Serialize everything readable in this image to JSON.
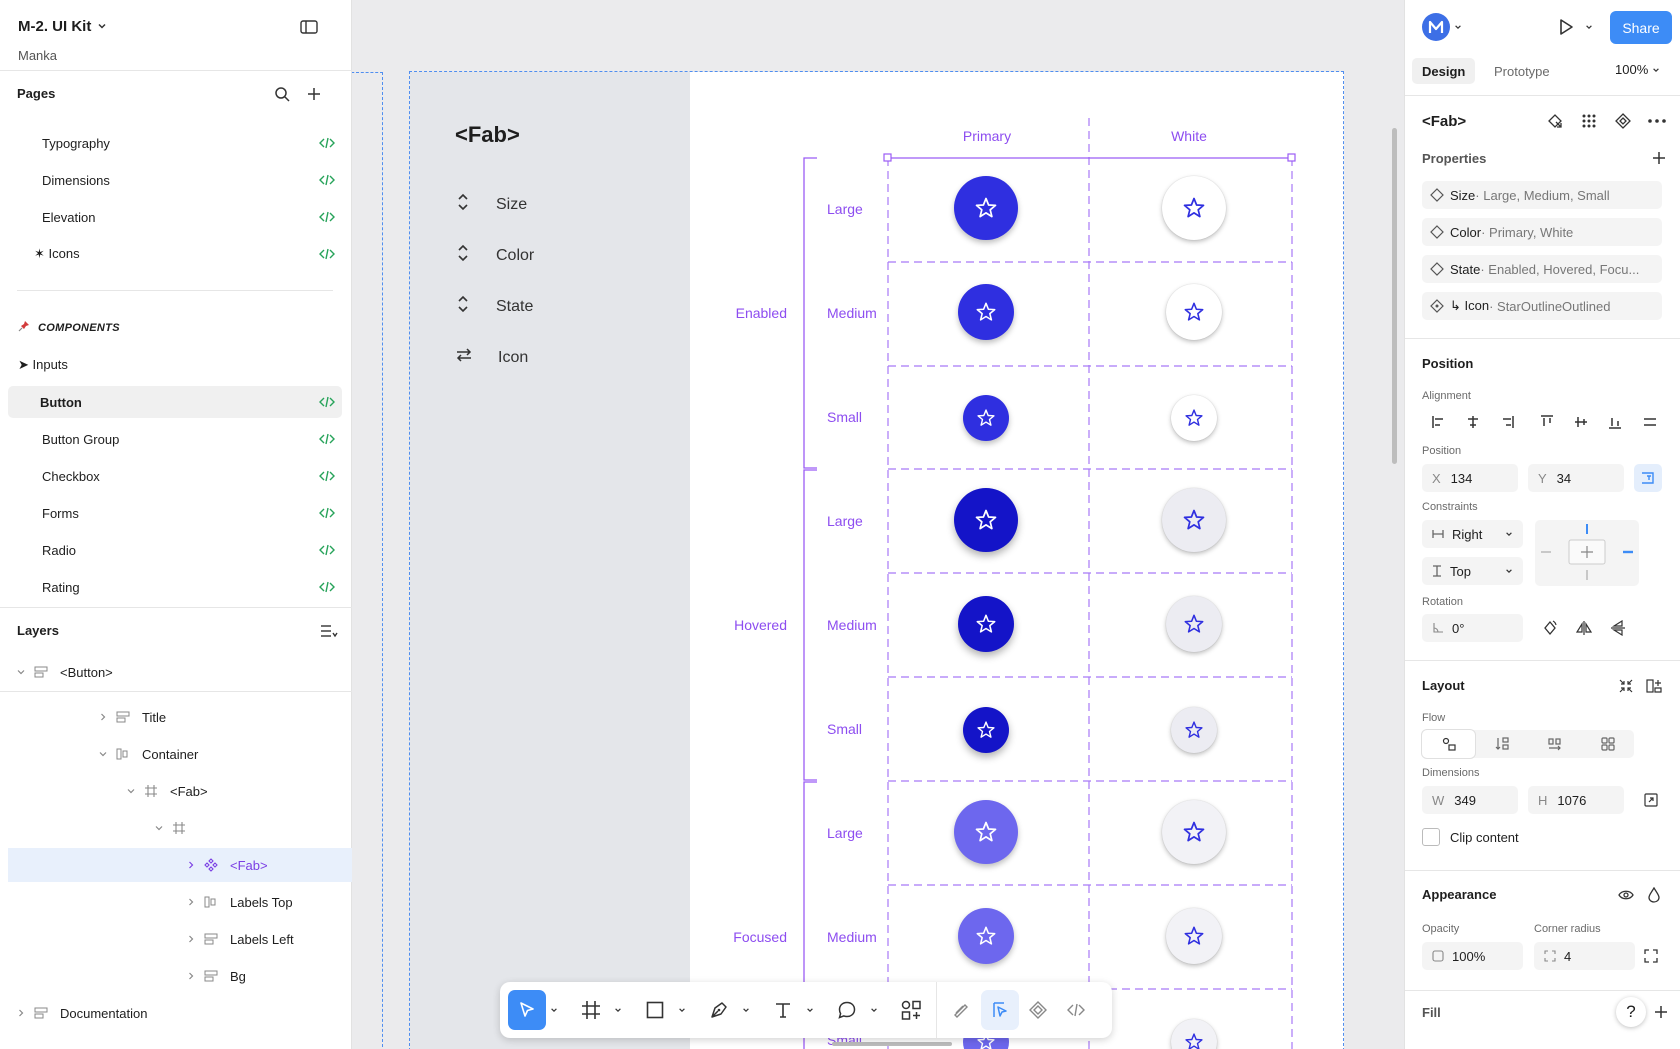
{
  "app": {
    "file_title": "M-2. UI Kit",
    "file_owner": "Manka"
  },
  "pages": {
    "heading": "Pages",
    "items": [
      {
        "label": "Typography"
      },
      {
        "label": "Dimensions"
      },
      {
        "label": "Elevation"
      },
      {
        "label": "✶ Icons"
      }
    ],
    "components_heading": "COMPONENTS",
    "component_items": [
      {
        "label": "➤ Inputs"
      },
      {
        "label": "Button"
      },
      {
        "label": "Button Group"
      },
      {
        "label": "Checkbox"
      },
      {
        "label": "Forms"
      },
      {
        "label": "Radio"
      },
      {
        "label": "Rating"
      }
    ]
  },
  "layers": {
    "heading": "Layers",
    "items": [
      {
        "label": "<Button>"
      },
      {
        "label": "Title"
      },
      {
        "label": "Container"
      },
      {
        "label": "<Fab>"
      },
      {
        "label": ""
      },
      {
        "label": "<Fab>"
      },
      {
        "label": "Labels Top"
      },
      {
        "label": "Labels Left"
      },
      {
        "label": "Bg"
      },
      {
        "label": "Documentation"
      }
    ]
  },
  "canvas": {
    "doc_title": "<Fab>",
    "doc_props": [
      {
        "label": "Size"
      },
      {
        "label": "Color"
      },
      {
        "label": "State"
      },
      {
        "label": "Icon"
      }
    ],
    "columns": [
      "Primary",
      "White"
    ],
    "groups": [
      "Enabled",
      "Hovered",
      "Focused"
    ],
    "sizes": [
      "Large",
      "Medium",
      "Small"
    ],
    "partial_label": "Small",
    "colors": {
      "enabled": "#2f2fe0",
      "hovered": "#1414c8",
      "focused": "#6d67ee",
      "guide": "#9b5cf5"
    }
  },
  "right": {
    "tabs": [
      "Design",
      "Prototype"
    ],
    "zoom": "100%",
    "share_label": "Share",
    "selection_name": "<Fab>",
    "properties_heading": "Properties",
    "properties": [
      {
        "key": "Size",
        "value": " · Large, Medium, Small"
      },
      {
        "key": "Color",
        "value": " · Primary, White"
      },
      {
        "key": "State",
        "value": " · Enabled, Hovered, Focu..."
      },
      {
        "key": "↳ Icon",
        "value": " · StarOutlineOutlined"
      }
    ],
    "position_heading": "Position",
    "alignment_label": "Alignment",
    "position_label": "Position",
    "x_label": "X",
    "x_value": "134",
    "y_label": "Y",
    "y_value": "34",
    "constraints_label": "Constraints",
    "constraint_h": "Right",
    "constraint_v": "Top",
    "rotation_label": "Rotation",
    "rotation_value": "0°",
    "layout_heading": "Layout",
    "flow_label": "Flow",
    "dimensions_label": "Dimensions",
    "w_label": "W",
    "w_value": "349",
    "h_label": "H",
    "h_value": "1076",
    "clip_label": "Clip content",
    "appearance_heading": "Appearance",
    "opacity_label": "Opacity",
    "opacity_value": "100%",
    "radius_label": "Corner radius",
    "radius_value": "4",
    "fill_heading": "Fill",
    "help_label": "?"
  }
}
